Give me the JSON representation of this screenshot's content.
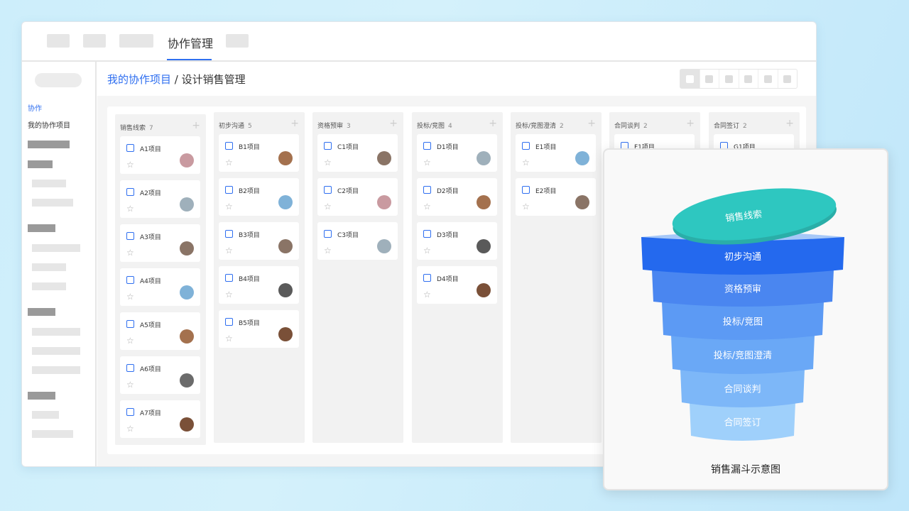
{
  "topbar": {
    "active_tab": "协作管理"
  },
  "sidebar": {
    "active_section": "协作",
    "item": "我的协作项目"
  },
  "breadcrumb": {
    "parent": "我的协作项目",
    "separator": "/",
    "current": "设计销售管理"
  },
  "board": {
    "accent": "#2f6ff0",
    "columns": [
      {
        "title": "销售线索",
        "count": "7",
        "cards": [
          {
            "name": "A1项目",
            "avatar": "#c99aa0"
          },
          {
            "name": "A2项目",
            "avatar": "#9fb0bb"
          },
          {
            "name": "A3项目",
            "avatar": "#8a7466"
          },
          {
            "name": "A4项目",
            "avatar": "#7fb2d8"
          },
          {
            "name": "A5项目",
            "avatar": "#a4714e"
          },
          {
            "name": "A6项目",
            "avatar": "#6b6b6b"
          },
          {
            "name": "A7项目",
            "avatar": "#7a5038"
          }
        ]
      },
      {
        "title": "初步沟通",
        "count": "5",
        "cards": [
          {
            "name": "B1项目",
            "avatar": "#a4714e"
          },
          {
            "name": "B2项目",
            "avatar": "#7fb2d8"
          },
          {
            "name": "B3项目",
            "avatar": "#8a7466"
          },
          {
            "name": "B4项目",
            "avatar": "#5a5a5a"
          },
          {
            "name": "B5项目",
            "avatar": "#7a5038"
          }
        ]
      },
      {
        "title": "资格预审",
        "count": "3",
        "cards": [
          {
            "name": "C1项目",
            "avatar": "#8a7466"
          },
          {
            "name": "C2项目",
            "avatar": "#c99aa0"
          },
          {
            "name": "C3项目",
            "avatar": "#9fb0bb"
          }
        ]
      },
      {
        "title": "投标/竞图",
        "count": "4",
        "cards": [
          {
            "name": "D1项目",
            "avatar": "#9fb0bb"
          },
          {
            "name": "D2项目",
            "avatar": "#a4714e"
          },
          {
            "name": "D3项目",
            "avatar": "#5a5a5a"
          },
          {
            "name": "D4项目",
            "avatar": "#7a5038"
          }
        ]
      },
      {
        "title": "投标/竞图澄清",
        "count": "2",
        "cards": [
          {
            "name": "E1项目",
            "avatar": "#7fb2d8"
          },
          {
            "name": "E2项目",
            "avatar": "#8a7466"
          }
        ]
      },
      {
        "title": "合同谈判",
        "count": "2",
        "cards": [
          {
            "name": "F1项目",
            "avatar": "#9fb0bb"
          }
        ]
      },
      {
        "title": "合同签订",
        "count": "2",
        "cards": [
          {
            "name": "G1项目",
            "avatar": "#9fb0bb"
          }
        ]
      }
    ]
  },
  "funnel": {
    "caption": "销售漏斗示意图",
    "top_label": "销售线索",
    "top_color": "#2ec7c0",
    "stages": [
      {
        "label": "初步沟通",
        "color": "#2469ee"
      },
      {
        "label": "资格预审",
        "color": "#4a86f0"
      },
      {
        "label": "投标/竞图",
        "color": "#5c9af4"
      },
      {
        "label": "投标/竞图澄清",
        "color": "#6aa8f6"
      },
      {
        "label": "合同谈判",
        "color": "#7db7f8"
      },
      {
        "label": "合同签订",
        "color": "#9fd0fb"
      }
    ]
  }
}
